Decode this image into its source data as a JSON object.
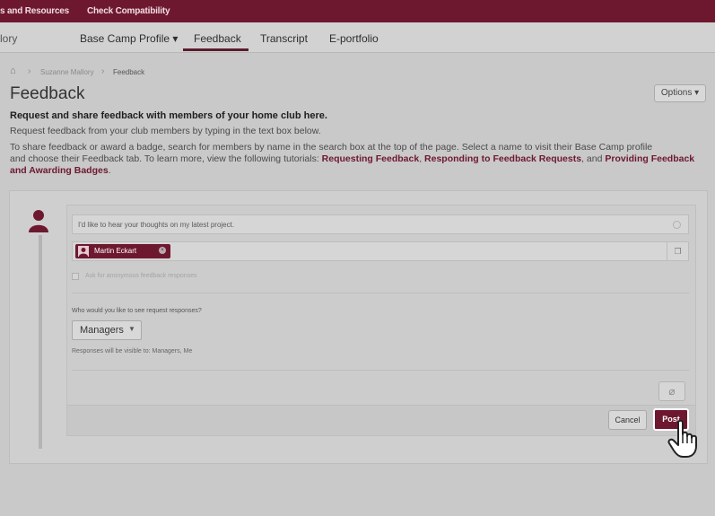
{
  "topbar": {
    "link_resources": "s and Resources",
    "link_compat": "Check Compatibility"
  },
  "nav": {
    "clipped_left": "lory",
    "items": [
      {
        "label": "Base Camp Profile ▾"
      },
      {
        "label": "Feedback"
      },
      {
        "label": "Transcript"
      },
      {
        "label": "E-portfolio"
      }
    ],
    "active": "Feedback"
  },
  "breadcrumb": {
    "home_icon": "home-icon",
    "sep": "›",
    "user": "Suzanne Mallory",
    "page": "Feedback"
  },
  "page": {
    "title": "Feedback",
    "options_label": "Options ▾",
    "lead": "Request and share feedback with members of your home club here.",
    "sub": "Request feedback from your club members by typing in the text box below.",
    "help_1": "To share feedback or award a badge, search for members by name in the search box at the top of the page. Select a name to visit their Base Camp profile",
    "help_2": "and choose their Feedback tab. To learn more, view the following tutorials: ",
    "link_1": "Requesting Feedback",
    "sep_1": ", ",
    "link_2": "Responding to Feedback Requests",
    "sep_2": ", and ",
    "link_3": "Providing Feedback",
    "help_3_link": "and Awarding Badges",
    "end": "."
  },
  "form": {
    "message": "I'd like to hear your thoughts on my latest project.",
    "recipient_chip": "Martin Eckart",
    "anonymous_label": "Ask for anonymous feedback responses",
    "anonymous_checked": false,
    "question": "Who would you like to see request responses?",
    "visibility_selected": "Managers",
    "visibility_note": "Responses will be visible to: Managers, Me",
    "cancel_label": "Cancel",
    "post_label": "Post"
  },
  "colors": {
    "brand": "#6e1830",
    "background": "#c9c9c9"
  }
}
